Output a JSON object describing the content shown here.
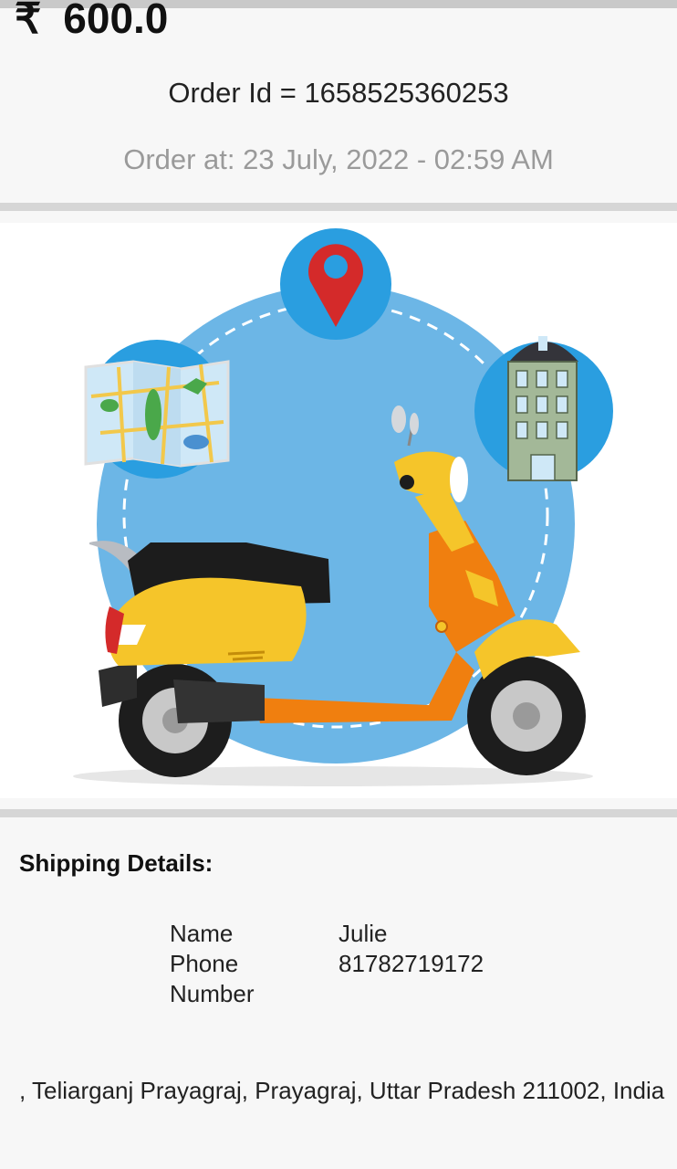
{
  "order": {
    "currency_symbol": "₹",
    "amount": "600.0",
    "order_id_text": "Order Id = 1658525360253",
    "order_at_text": "Order at: 23 July, 2022 - 02:59 AM"
  },
  "illustration": {
    "icons": [
      "location-pin-icon",
      "map-icon",
      "building-icon",
      "scooter-icon"
    ],
    "colors": {
      "circle": "#6cb6e6",
      "scooter_yellow": "#f5c52a",
      "scooter_orange": "#f07f0f",
      "pin_red": "#d42a2a"
    }
  },
  "shipping": {
    "title": "Shipping Details:",
    "rows": [
      {
        "key": "Name",
        "value": "Julie"
      },
      {
        "key": "Phone Number",
        "value": "81782719172"
      }
    ],
    "address": ", Teliarganj Prayagraj, Prayagraj, Uttar Pradesh 211002, India"
  }
}
